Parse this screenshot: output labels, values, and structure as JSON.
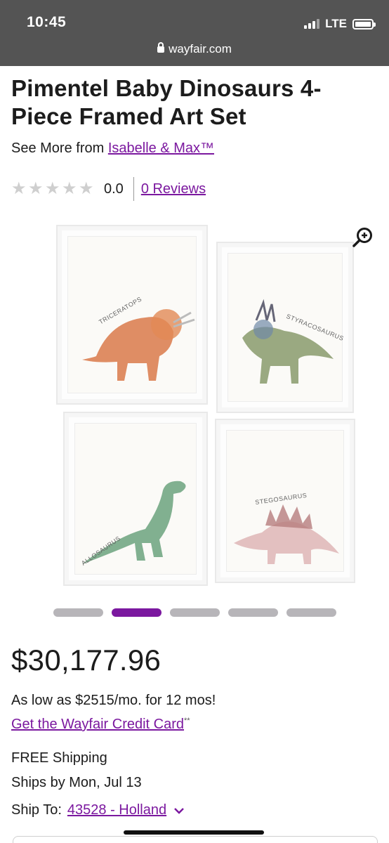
{
  "status_bar": {
    "time": "10:45",
    "network": "LTE"
  },
  "browser": {
    "url": "wayfair.com"
  },
  "product": {
    "title": "Pimentel Baby Dinosaurs 4-Piece Framed Art Set",
    "see_more_prefix": "See More from ",
    "brand": "Isabelle & Max™",
    "rating_value": "0.0",
    "rating_stars": 0,
    "reviews_label": "0 Reviews"
  },
  "gallery": {
    "panels": [
      {
        "label": "TRICERATOPS"
      },
      {
        "label": "STYRACOSAURUS"
      },
      {
        "label": "ALLOSAURUS"
      },
      {
        "label": "STEGOSAURUS"
      }
    ],
    "image_count": 5,
    "active_index": 1,
    "colors": {
      "active_dot": "#7b189f",
      "inactive_dot": "#b7b5b9"
    }
  },
  "pricing": {
    "price": "$30,177.96",
    "monthly": "As low as $2515/mo. for 12 mos!",
    "credit_link": "Get the Wayfair Credit Card",
    "credit_mark": "**"
  },
  "shipping": {
    "free": "FREE Shipping",
    "ships_by": "Ships by Mon, Jul 13",
    "ship_to_label": "Ship To:",
    "ship_to_value": "43528 - Holland"
  },
  "theme": {
    "accent": "#7b189f",
    "topbar": "#545454"
  }
}
